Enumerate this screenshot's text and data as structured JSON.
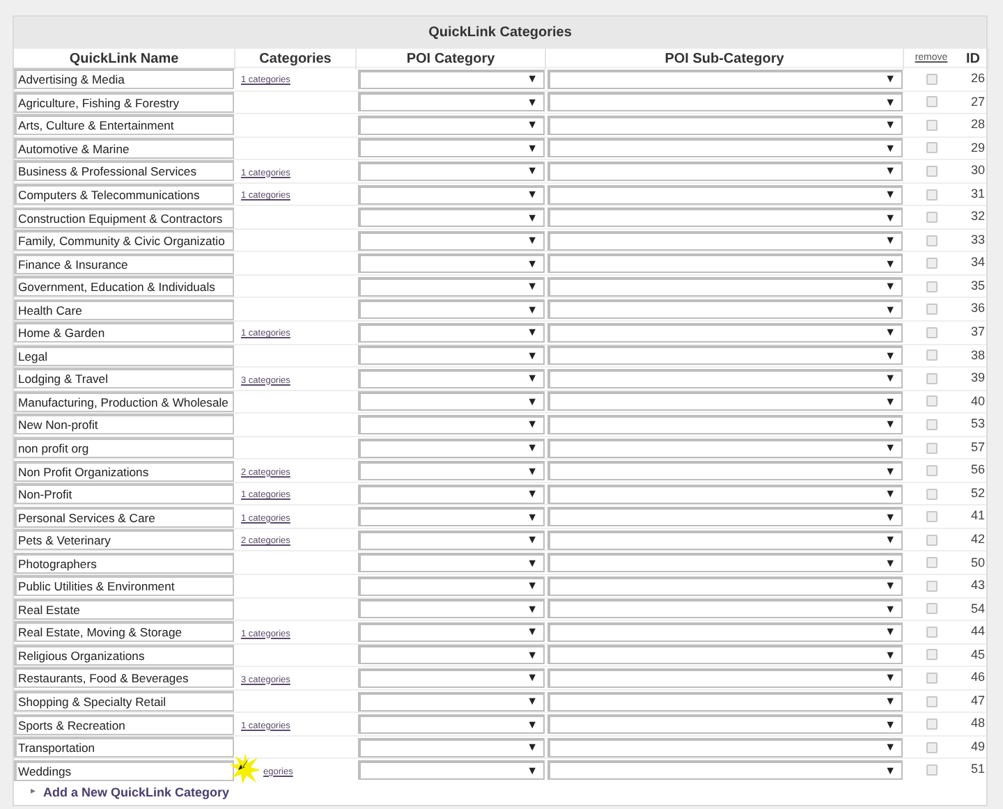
{
  "title": "QuickLink Categories",
  "columns": [
    "QuickLink Name",
    "Categories",
    "POI Category",
    "POI Sub-Category",
    "remove",
    "ID"
  ],
  "rows": [
    {
      "name": "Advertising & Media",
      "categories": "1 categories",
      "remove": false,
      "id": "26"
    },
    {
      "name": "Agriculture, Fishing & Forestry",
      "remove": false,
      "id": "27"
    },
    {
      "name": "Arts, Culture & Entertainment",
      "remove": false,
      "id": "28"
    },
    {
      "name": "Automotive & Marine",
      "remove": false,
      "id": "29"
    },
    {
      "name": "Business & Professional Services",
      "categories": "1 categories",
      "remove": false,
      "id": "30"
    },
    {
      "name": "Computers & Telecommunications",
      "categories": "1 categories",
      "remove": false,
      "id": "31"
    },
    {
      "name": "Construction Equipment & Contractors",
      "remove": false,
      "id": "32"
    },
    {
      "name": "Family, Community & Civic Organizatio",
      "remove": false,
      "id": "33"
    },
    {
      "name": "Finance & Insurance",
      "remove": false,
      "id": "34"
    },
    {
      "name": "Government, Education & Individuals",
      "remove": false,
      "id": "35"
    },
    {
      "name": "Health Care",
      "remove": false,
      "id": "36"
    },
    {
      "name": "Home & Garden",
      "categories": "1 categories",
      "remove": false,
      "id": "37"
    },
    {
      "name": "Legal",
      "remove": false,
      "id": "38"
    },
    {
      "name": "Lodging & Travel",
      "categories": "3 categories",
      "remove": false,
      "id": "39"
    },
    {
      "name": "Manufacturing, Production & Wholesale",
      "remove": false,
      "id": "40"
    },
    {
      "name": "New Non-profit",
      "remove": false,
      "id": "53"
    },
    {
      "name": "non profit org",
      "remove": false,
      "id": "57"
    },
    {
      "name": "Non Profit Organizations",
      "categories": "2 categories",
      "remove": false,
      "id": "56"
    },
    {
      "name": "Non-Profit",
      "categories": "1 categories",
      "remove": false,
      "id": "52"
    },
    {
      "name": "Personal Services & Care",
      "categories": "1 categories",
      "remove": false,
      "id": "41"
    },
    {
      "name": "Pets & Veterinary",
      "categories": "2 categories",
      "remove": false,
      "id": "42"
    },
    {
      "name": "Photographers",
      "remove": false,
      "id": "50"
    },
    {
      "name": "Public Utilities & Environment",
      "remove": false,
      "id": "43"
    },
    {
      "name": "Real Estate",
      "remove": false,
      "id": "54"
    },
    {
      "name": "Real Estate, Moving & Storage",
      "categories": "1 categories",
      "remove": false,
      "id": "44"
    },
    {
      "name": "Religious Organizations",
      "remove": false,
      "id": "45"
    },
    {
      "name": "Restaurants, Food & Beverages",
      "categories": "3 categories",
      "remove": false,
      "id": "46"
    },
    {
      "name": "Shopping & Specialty Retail",
      "remove": false,
      "id": "47"
    },
    {
      "name": "Sports & Recreation",
      "categories": "1 categories",
      "remove": false,
      "id": "48"
    },
    {
      "name": "Transportation",
      "remove": false,
      "id": "49"
    },
    {
      "name": "Weddings",
      "categories": "egories",
      "cursor": true,
      "remove": false,
      "id": "51"
    }
  ],
  "dropdown_arrow": "▼",
  "add_link": {
    "arrow": "▸",
    "label": "Add a New QuickLink Category"
  }
}
